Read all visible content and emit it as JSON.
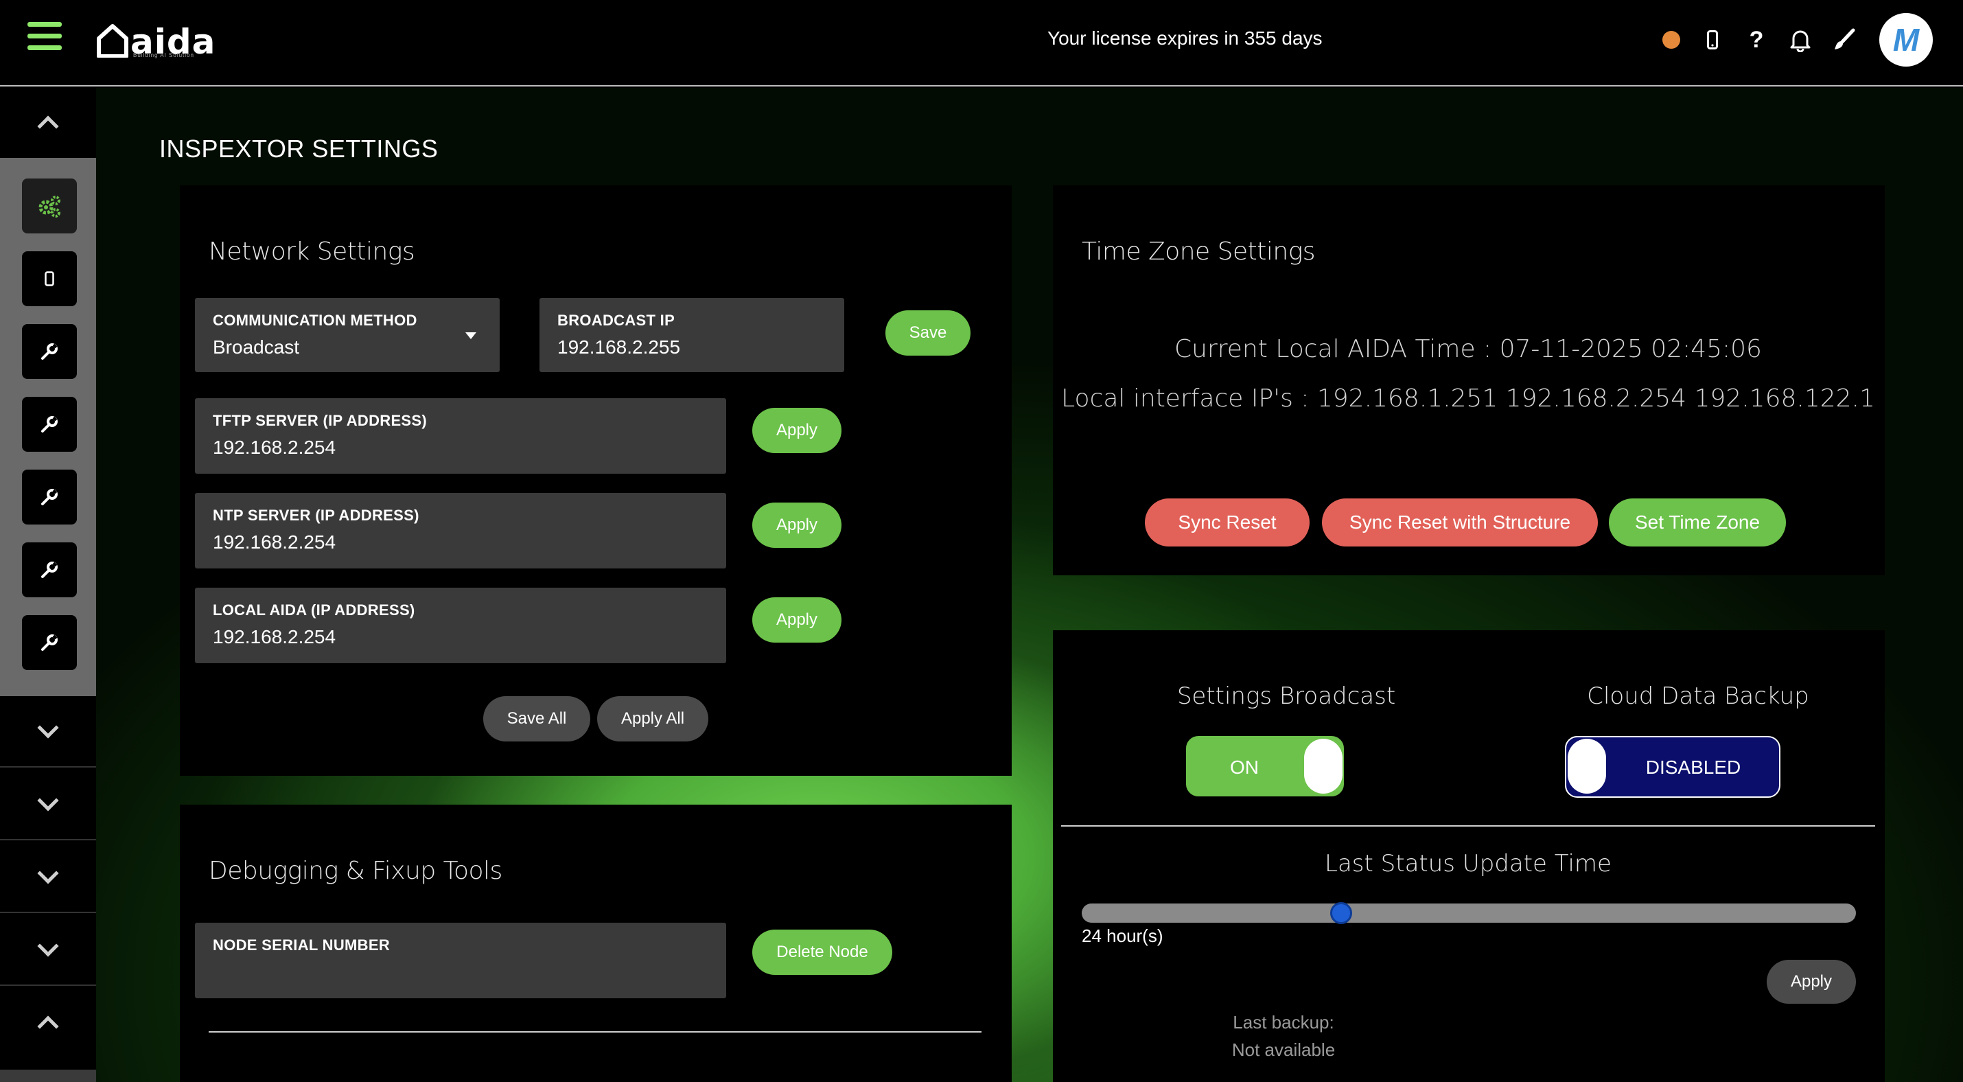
{
  "header": {
    "logo_text": "aida",
    "logo_tagline": "Building AI Solution",
    "license_text": "Your license expires in 355 days",
    "status_color": "#e58a3a",
    "icons": [
      "menu-icon",
      "mobile-icon",
      "help-icon",
      "bell-icon",
      "brush-icon"
    ],
    "help_glyph": "?",
    "avatar_letter": "M"
  },
  "rail": {
    "icons": [
      "settings-gears-icon",
      "mobile-icon",
      "wrench-icon",
      "wrench-icon",
      "wrench-icon",
      "wrench-icon",
      "wrench-icon"
    ]
  },
  "page": {
    "title": "INSPEXTOR SETTINGS"
  },
  "network": {
    "title": "Network Settings",
    "comm_method_label": "COMMUNICATION METHOD",
    "comm_method_value": "Broadcast",
    "broadcast_ip_label": "BROADCAST IP",
    "broadcast_ip_value": "192.168.2.255",
    "save_label": "Save",
    "tftp_label": "TFTP SERVER (IP ADDRESS)",
    "tftp_value": "192.168.2.254",
    "ntp_label": "NTP SERVER (IP ADDRESS)",
    "ntp_value": "192.168.2.254",
    "local_aida_label": "LOCAL AIDA (IP ADDRESS)",
    "local_aida_value": "192.168.2.254",
    "apply_label": "Apply",
    "save_all_label": "Save All",
    "apply_all_label": "Apply All"
  },
  "debug": {
    "title": "Debugging & Fixup Tools",
    "node_serial_label": "NODE SERIAL NUMBER",
    "node_serial_value": "",
    "delete_node_label": "Delete Node"
  },
  "timezone": {
    "title": "Time Zone Settings",
    "current_time": "Current Local AIDA Time : 07-11-2025 02:45:06",
    "local_ips": "Local interface IP's : 192.168.1.251 192.168.2.254 192.168.122.1",
    "sync_reset_label": "Sync Reset",
    "sync_reset_structure_label": "Sync Reset with Structure",
    "set_time_zone_label": "Set Time Zone"
  },
  "broadcast": {
    "settings_broadcast_label": "Settings Broadcast",
    "settings_broadcast_state": "ON",
    "cloud_backup_label": "Cloud Data Backup",
    "cloud_backup_state": "DISABLED",
    "last_status_title": "Last Status Update Time",
    "slider_value_fraction": 0.33,
    "slider_value_text": "24 hour(s)",
    "apply_label": "Apply",
    "last_backup_label": "Last backup:",
    "last_backup_value": "Not available"
  },
  "colors": {
    "accent_green": "#6cc24a",
    "danger_red": "#e2625a",
    "toggle_navy": "#0b0f6b",
    "slider_blue": "#1e5fd6"
  }
}
